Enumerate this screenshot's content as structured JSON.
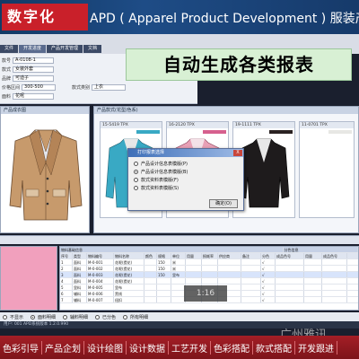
{
  "banner": {
    "logo_text": "数字化",
    "title": "APD ( Apparel Product Development ) 服装产品开发"
  },
  "tabs": [
    {
      "label": "文件"
    },
    {
      "label": "开发进度"
    },
    {
      "label": "产品开发管理"
    },
    {
      "label": "文档"
    }
  ],
  "callout": "自动生成各类报表",
  "form": {
    "rows": [
      {
        "label": "款号",
        "value": "A-0108-1"
      },
      {
        "label": "款式",
        "value": "女装外套"
      },
      {
        "label": "品牌",
        "value": "可迪子"
      },
      {
        "label": "价格区间",
        "value": "300-500"
      },
      {
        "label": "面料",
        "value": "花呢"
      }
    ],
    "right_label": "款式类别",
    "right_value": "上衣"
  },
  "left_panel": {
    "header": "产品成衣图"
  },
  "right_panel": {
    "header": "产品款式(花型/色系)",
    "thumbs": [
      {
        "label": "15-5419 TPX",
        "swatch": "#39a9c4"
      },
      {
        "label": "16-2120 TPX",
        "swatch": "#d6608e"
      },
      {
        "label": "19-1111 TPX",
        "swatch": "#2a2222"
      },
      {
        "label": "11-0701 TPX",
        "swatch": "#e7e7e4"
      }
    ]
  },
  "dialog": {
    "title": "打印报表选择",
    "close": "X",
    "options": [
      {
        "label": "产品设计信息表模版(P)",
        "selected": false
      },
      {
        "label": "产品设计信息表模版(B)",
        "selected": true
      },
      {
        "label": "款式资料表模版(F)",
        "selected": false
      },
      {
        "label": "款式资料表模版(S)",
        "selected": false
      }
    ],
    "ok": "确定(O)"
  },
  "grid": {
    "headers": [
      "序号",
      "类型",
      "物料编号",
      "物料名称",
      "颜色",
      "规格",
      "单位",
      "用量",
      "损耗率",
      "供应商",
      "备注",
      "分色",
      "成品色号",
      "用量",
      "成品色号"
    ],
    "group_left": "物料基础信息",
    "group_right": "分色信息",
    "rows": [
      [
        "1",
        "面料",
        "M-0-001",
        "花呢(提花)",
        "",
        "150",
        "米",
        "",
        "",
        "",
        "",
        "√",
        "",
        "",
        ""
      ],
      [
        "2",
        "面料",
        "M-0-002",
        "花呢(提花)",
        "",
        "150",
        "米",
        "",
        "",
        "",
        "",
        "√",
        "",
        "",
        ""
      ],
      [
        "3",
        "面料",
        "M-0-003",
        "花呢(提花)",
        "",
        "150",
        "里布",
        "",
        "",
        "",
        "",
        "√",
        "",
        "",
        ""
      ],
      [
        "4",
        "面料",
        "M-0-004",
        "花呢(提花)",
        "",
        "",
        "",
        "",
        "",
        "",
        "",
        "√",
        "",
        "",
        ""
      ],
      [
        "5",
        "里料",
        "M-0-005",
        "里布",
        "",
        "",
        "",
        "",
        "",
        "",
        "",
        "√",
        "",
        "",
        ""
      ],
      [
        "6",
        "辅料",
        "M-0-006",
        "黑线",
        "",
        "",
        "",
        "",
        "",
        "",
        "",
        "√",
        "",
        "",
        ""
      ],
      [
        "7",
        "辅料",
        "M-0-007",
        "纽扣",
        "",
        "",
        "",
        "",
        "",
        "",
        "",
        "√",
        "",
        "",
        ""
      ]
    ]
  },
  "video_time": "1:16",
  "bottom_opts": [
    {
      "label": "不显示",
      "selected": false
    },
    {
      "label": "面料明细",
      "selected": true
    },
    {
      "label": "辅料明细",
      "selected": false
    },
    {
      "label": "已分色",
      "selected": false
    },
    {
      "label": "所有明细",
      "selected": false
    }
  ],
  "status": "用户: 001   APD系统版本   1.2.0.990",
  "watermark": "广州雅讯",
  "footer": [
    "色彩引导",
    "产品企划",
    "设计绘图",
    "设计数据",
    "工艺开发",
    "色彩搭配",
    "款式搭配",
    "开发跟进"
  ]
}
